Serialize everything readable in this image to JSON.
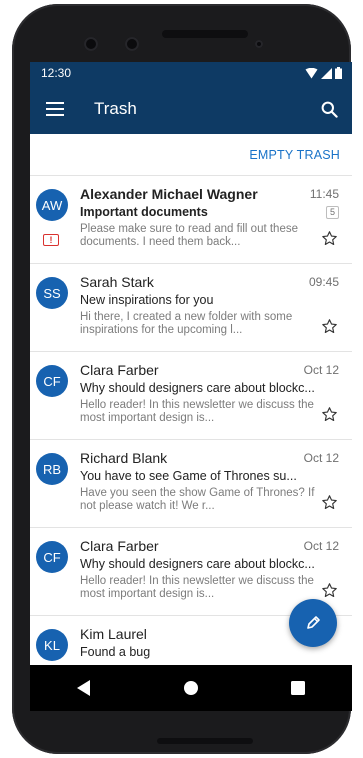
{
  "status": {
    "time": "12:30"
  },
  "appbar": {
    "title": "Trash",
    "menu_icon": "hamburger-menu-icon",
    "search_icon": "search-icon"
  },
  "actions": {
    "empty_trash": "EMPTY TRASH"
  },
  "emails": [
    {
      "initials": "AW",
      "sender": "Alexander Michael Wagner",
      "time": "11:45",
      "count": "5",
      "important": true,
      "important_label": "!",
      "subject": "Important documents",
      "preview": "Please make sure to read and fill out these documents. I need them back...",
      "unread": true
    },
    {
      "initials": "SS",
      "sender": "Sarah Stark",
      "time": "09:45",
      "subject": "New inspirations for you",
      "preview": "Hi there, I created a new folder with some inspirations for the upcoming l...",
      "unread": false
    },
    {
      "initials": "CF",
      "sender": "Clara Farber",
      "time": "Oct 12",
      "subject": "Why should designers care about blockc...",
      "preview": "Hello reader! In this newsletter we discuss the most important design is...",
      "unread": false
    },
    {
      "initials": "RB",
      "sender": "Richard Blank",
      "time": "Oct 12",
      "subject": "You have to see Game of Thrones su...",
      "preview": "Have you seen the show Game of Thrones? If not please watch it! We r...",
      "unread": false
    },
    {
      "initials": "CF",
      "sender": "Clara Farber",
      "time": "Oct 12",
      "subject": "Why should designers care about blockc...",
      "preview": "Hello reader! In this newsletter we discuss the most important design is...",
      "unread": false
    },
    {
      "initials": "KL",
      "sender": "Kim Laurel",
      "time": "",
      "subject": "Found a bug",
      "preview": "",
      "unread": false
    }
  ],
  "colors": {
    "primary": "#0e3a64",
    "accent": "#1762b0",
    "link": "#1a73c8",
    "important": "#d9322f"
  },
  "fab": {
    "icon": "pencil-icon"
  },
  "nav": {
    "back_icon": "back-triangle-icon",
    "home_icon": "home-circle-icon",
    "recents_icon": "recents-square-icon"
  }
}
